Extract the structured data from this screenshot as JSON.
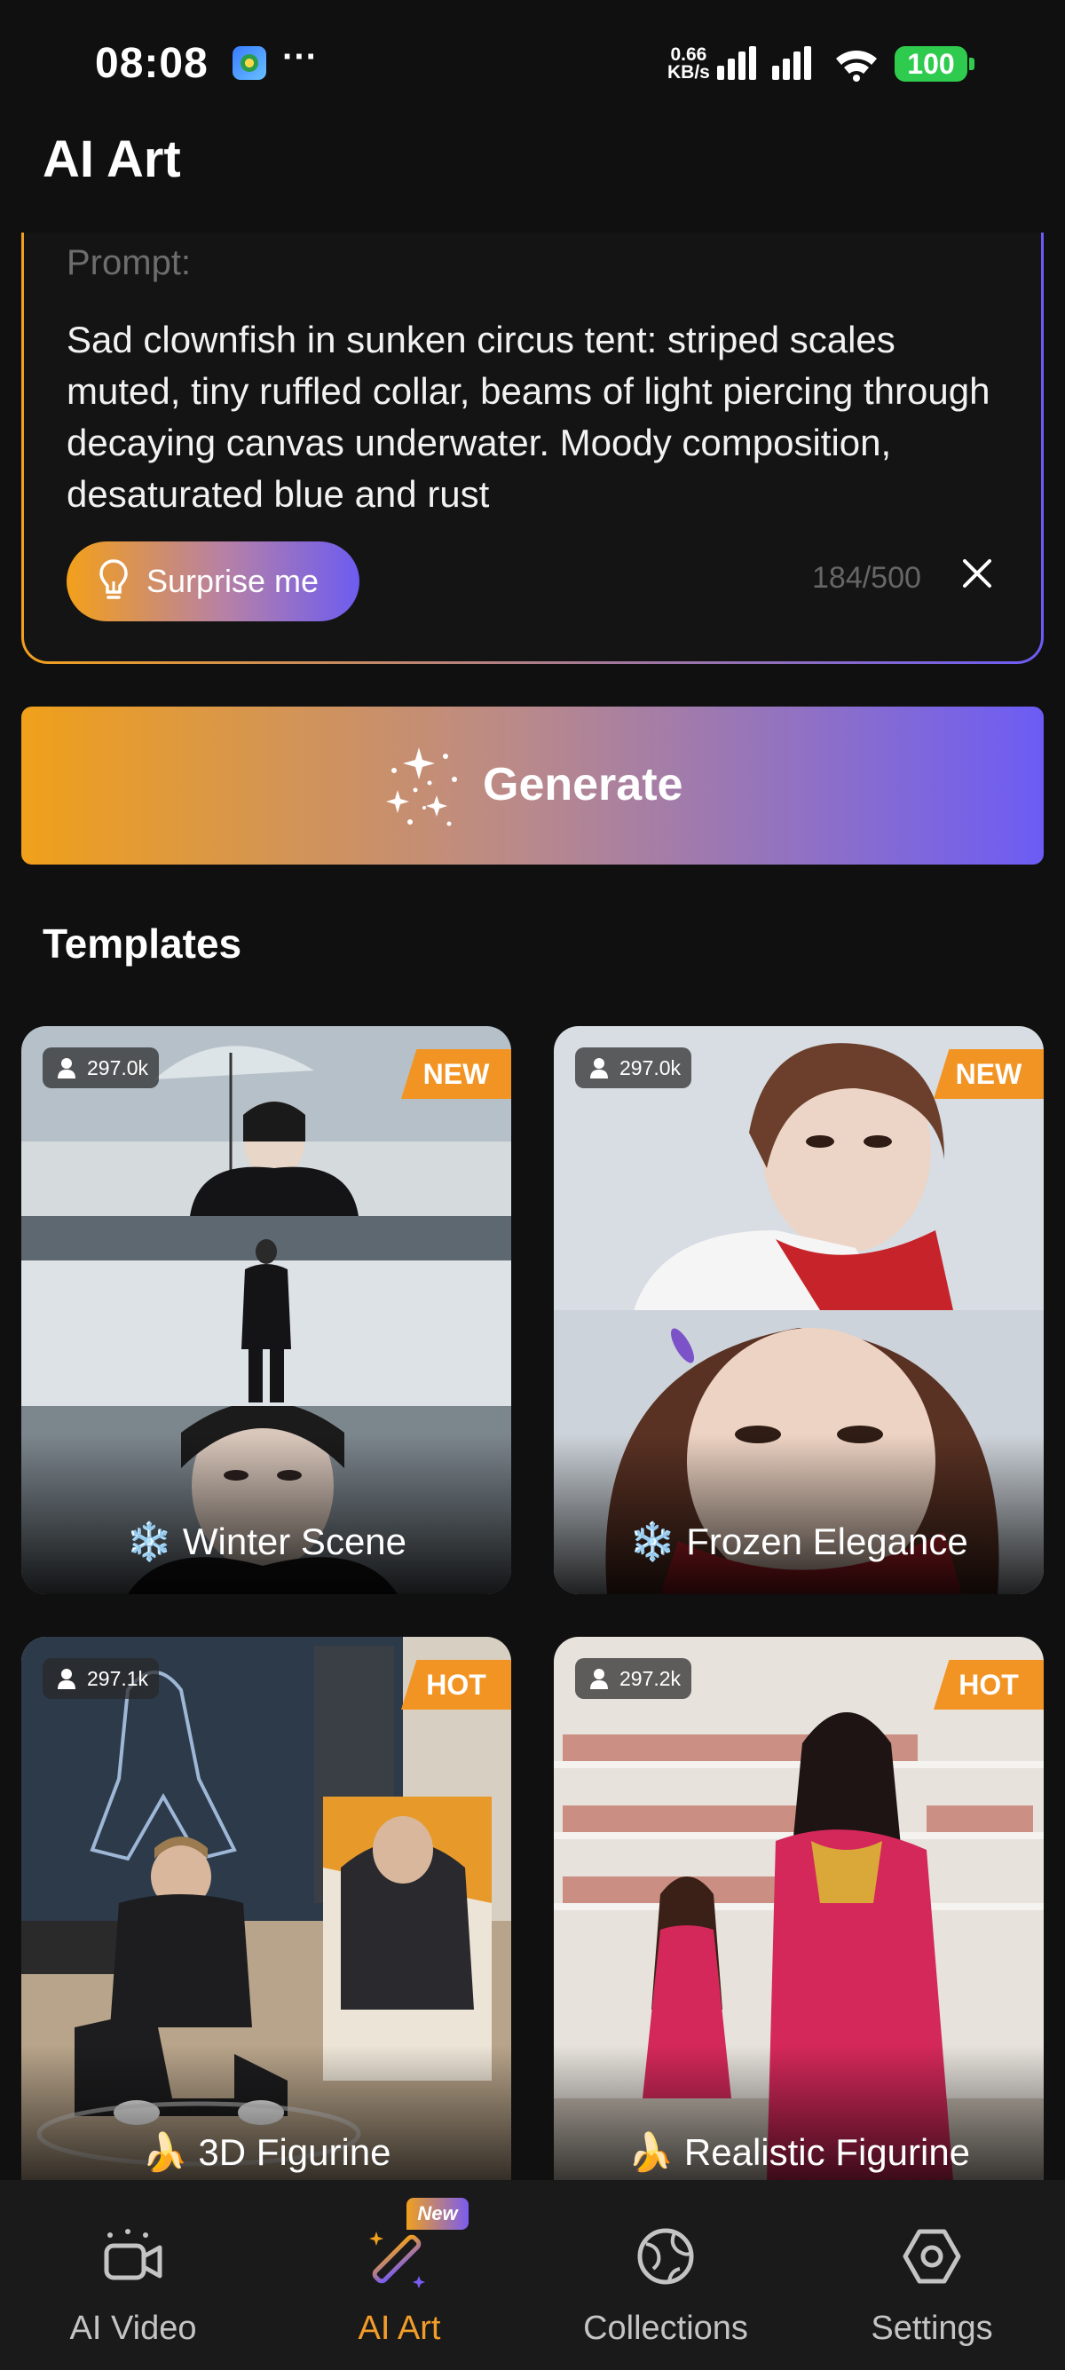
{
  "status_bar": {
    "time": "08:08",
    "more": "···",
    "net_speed_value": "0.66",
    "net_speed_unit": "KB/s",
    "battery": "100"
  },
  "page_title": "AI Art",
  "prompt": {
    "label": "Prompt:",
    "text": "Sad clownfish in sunken circus tent: striped scales muted, tiny ruffled collar, beams of light piercing through decaying canvas underwater. Moody composition, desaturated blue and rust",
    "surprise_label": "Surprise me",
    "char_count": "184/500"
  },
  "generate_label": "Generate",
  "templates": {
    "title": "Templates",
    "cards": [
      {
        "title": "❄️ Winter Scene",
        "users": "297.0k",
        "tag": "NEW"
      },
      {
        "title": "❄️ Frozen Elegance",
        "users": "297.0k",
        "tag": "NEW"
      },
      {
        "title": "🍌 3D Figurine",
        "users": "297.1k",
        "tag": "HOT"
      },
      {
        "title": "🍌 Realistic Figurine",
        "users": "297.2k",
        "tag": "HOT"
      }
    ]
  },
  "bottom_nav": {
    "items": [
      {
        "label": "AI Video",
        "icon": "video-camera-icon"
      },
      {
        "label": "AI Art",
        "icon": "magic-wand-icon",
        "badge": "New",
        "active": true
      },
      {
        "label": "Collections",
        "icon": "globe-icon"
      },
      {
        "label": "Settings",
        "icon": "hexagon-gear-icon"
      }
    ]
  },
  "colors": {
    "accent_orange": "#f29423",
    "accent_purple": "#6c5cf5",
    "background": "#101010"
  }
}
